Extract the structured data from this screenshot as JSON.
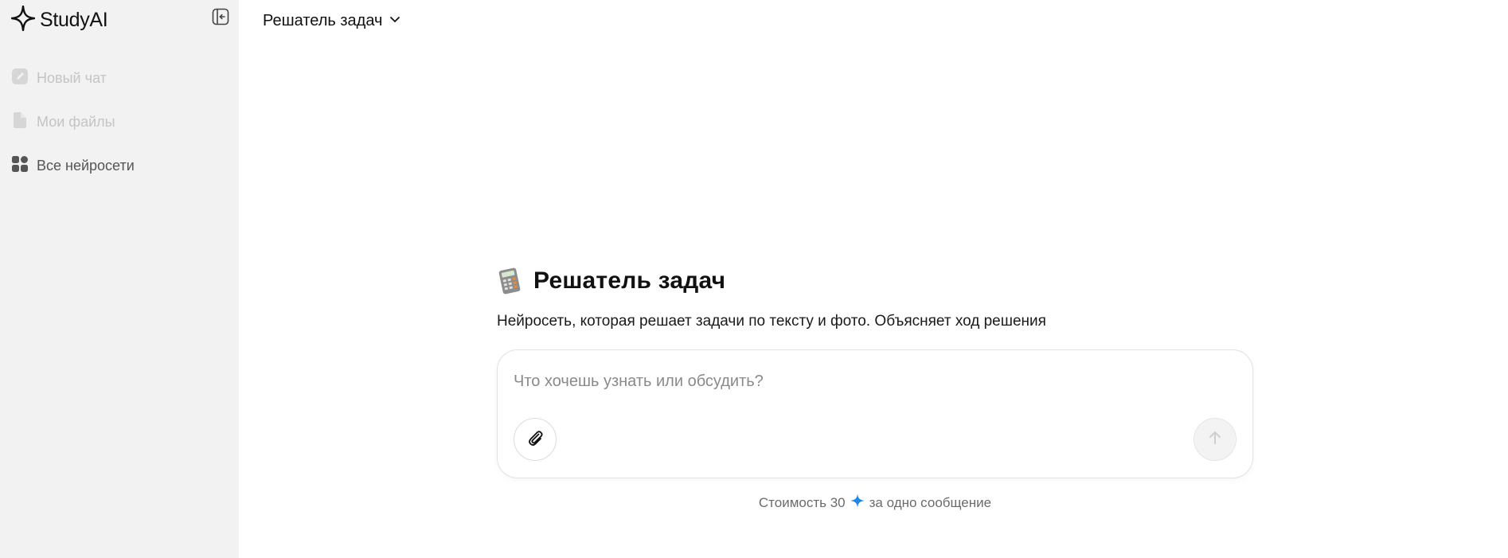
{
  "app": {
    "name": "StudyAI"
  },
  "sidebar": {
    "items": [
      {
        "label": "Новый чат",
        "icon": "edit-icon",
        "state": "disabled"
      },
      {
        "label": "Мои файлы",
        "icon": "file-icon",
        "state": "disabled"
      },
      {
        "label": "Все нейросети",
        "icon": "grid-icon",
        "state": "active"
      }
    ]
  },
  "header": {
    "title": "Решатель задач",
    "dropdown_icon": "chevron-down-icon"
  },
  "hero": {
    "icon": "calculator-icon",
    "title": "Решатель задач",
    "description": "Нейросеть, которая решает задачи по тексту и фото. Объясняет ход решения"
  },
  "composer": {
    "placeholder": "Что хочешь узнать или обсудить?",
    "value": "",
    "attach_icon": "paperclip-icon",
    "send_icon": "arrow-up-icon"
  },
  "cost": {
    "prefix": "Стоимость 30",
    "suffix": "за одно сообщение",
    "icon": "sparkle-icon"
  },
  "colors": {
    "sidebar_bg": "#f2f2f2",
    "accent": "#1e88e5"
  }
}
